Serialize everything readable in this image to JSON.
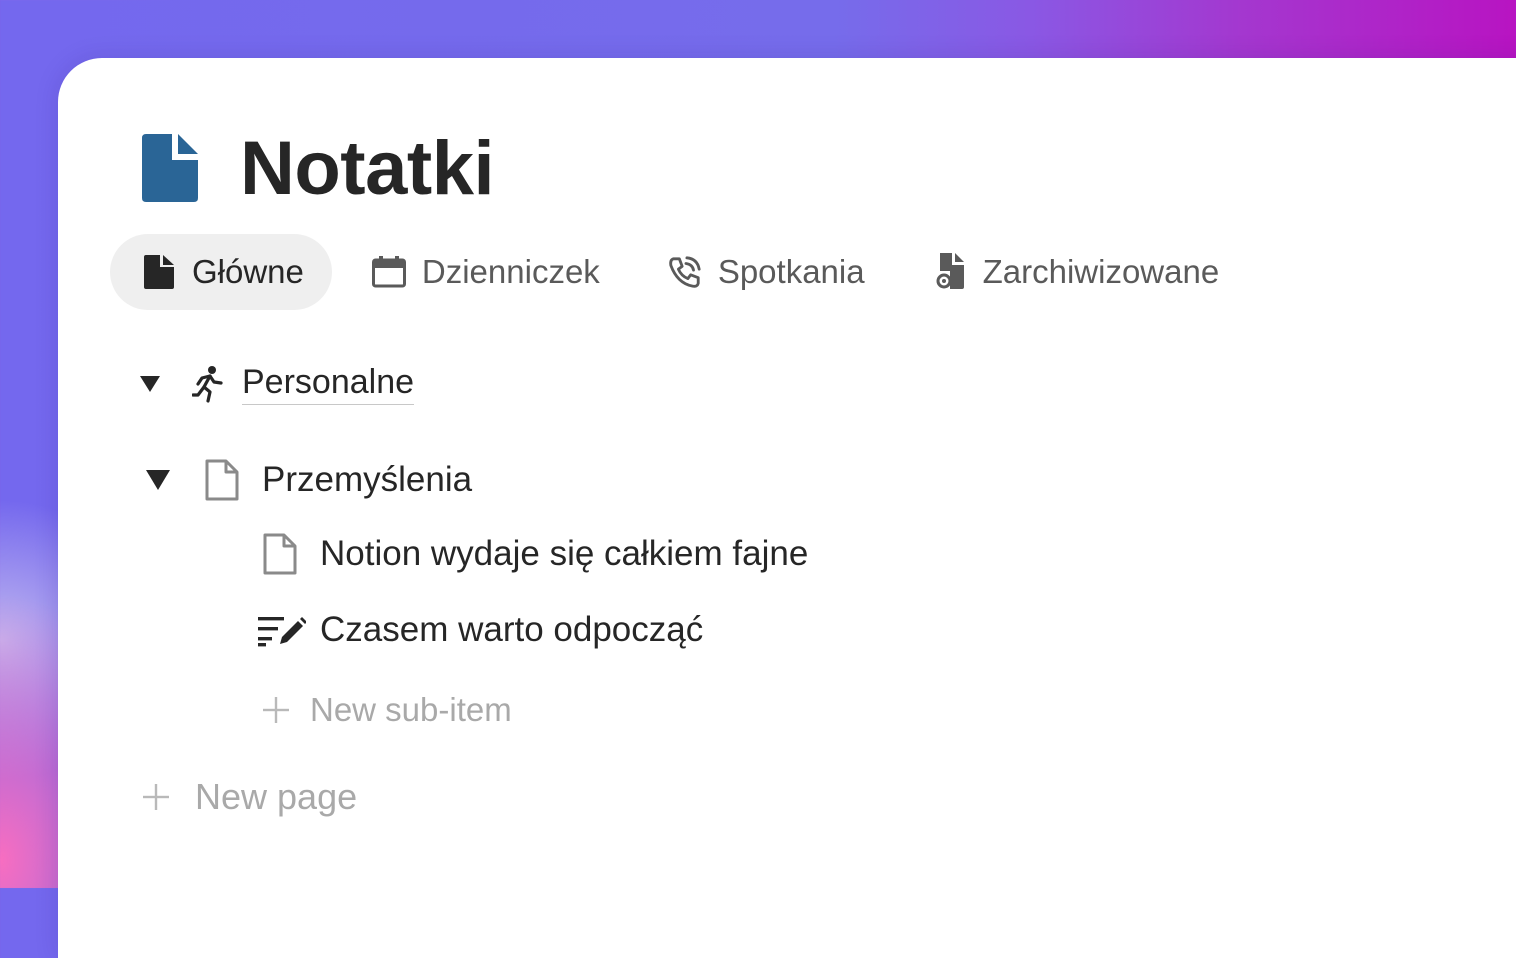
{
  "page": {
    "title": "Notatki",
    "title_icon": "document-icon",
    "accent_color": "#2a6596"
  },
  "tabs": [
    {
      "label": "Główne",
      "icon": "document-filled-icon",
      "active": true
    },
    {
      "label": "Dzienniczek",
      "icon": "calendar-icon",
      "active": false
    },
    {
      "label": "Spotkania",
      "icon": "phone-call-icon",
      "active": false
    },
    {
      "label": "Zarchiwizowane",
      "icon": "archived-document-icon",
      "active": false
    }
  ],
  "tree": {
    "section": {
      "label": "Personalne",
      "icon": "running-person-icon",
      "expanded": true
    },
    "group": {
      "label": "Przemyślenia",
      "icon": "page-outline-icon",
      "expanded": true
    },
    "children": [
      {
        "label": "Notion wydaje się całkiem fajne",
        "icon": "page-outline-icon"
      },
      {
        "label": "Czasem warto odpocząć",
        "icon": "edit-lines-icon"
      }
    ],
    "new_sub_item": "New sub-item"
  },
  "new_page": "New page"
}
